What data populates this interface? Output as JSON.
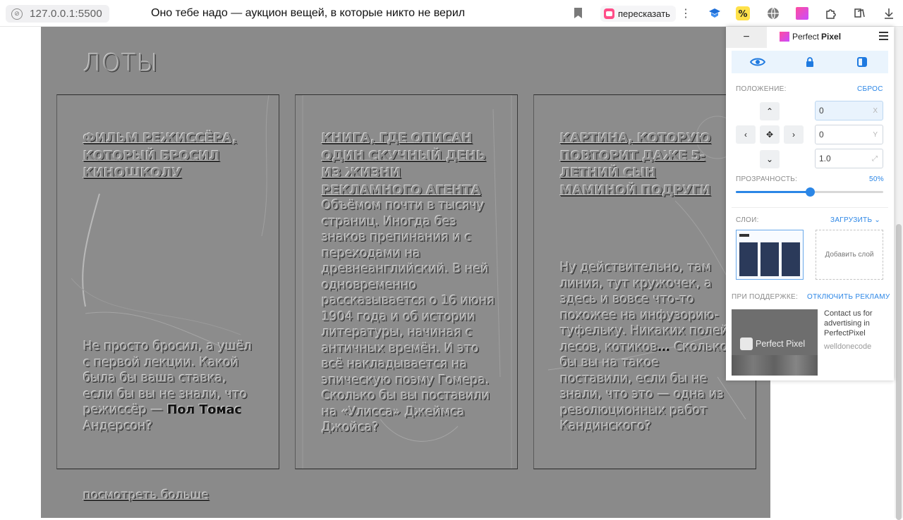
{
  "browser": {
    "url": "127.0.0.1:5500",
    "page_title": "Оно тебе надо — аукцион вещей, в которые никто не верил",
    "retell_label": "пересказать",
    "more_label": "⋮"
  },
  "section": {
    "title": "ЛОТЫ",
    "more_link": "посмотреть больше"
  },
  "cards": [
    {
      "title": "ФИЛЬМ РЕЖИССЁРА, КОТОРЫЙ БРОСИЛ КИНОШКОЛУ",
      "body_before": "Не просто бросил, а ушёл с первой лекции. Какой была бы ваша ставка, если бы вы не знали, что режиссёр — ",
      "body_highlight": "Пол Томас",
      "body_after": " Андерсон?"
    },
    {
      "title": "КНИГА, ГДЕ ОПИСАН ОДИН СКУЧНЫЙ ДЕНЬ ИЗ ЖИЗНИ РЕКЛАМНОГО АГЕНТА",
      "body_before": "Объёмом почти в тысячу страниц. Иногда без знаков препинания и с переходами на древнеанглийский. В ней одновременно рассказывается о 16 июня 1904 года и об истории литературы, начиная с античных времён. И это всё накладывается на эпическую поэму Гомера. Сколько бы вы поставили на «Улисса» Джеймса Джойса?",
      "body_highlight": "",
      "body_after": ""
    },
    {
      "title": "КАРТИНА, КОТОРУЮ ПОВТОРИТ ДАЖЕ 5-ЛЕТНИЙ СЫН МАМИНОЙ ПОДРУГИ",
      "body_before": "Ну действительно, там линия, тут кружочек, а здесь и вовсе что-то похожее на инфузорию-туфельку. Никаких полей, лесов, котиков",
      "body_highlight": "… ",
      "body_after": "Сколько бы вы на такое поставили, если бы не знали, что это — одна из революционных работ Кандинского?"
    }
  ],
  "perfect_pixel": {
    "minimize": "−",
    "brand_light": "Perfect",
    "brand_bold": "Pixel",
    "position_label": "ПОЛОЖЕНИЕ:",
    "reset_label": "СБРОС",
    "x_value": "0",
    "x_unit": "X",
    "y_value": "0",
    "y_unit": "Y",
    "scale_value": "1.0",
    "scale_unit": "⤢",
    "opacity_label": "ПРОЗРАЧНОСТЬ:",
    "opacity_value": "50%",
    "opacity_fraction": 0.5,
    "layers_label": "СЛОИ:",
    "upload_label": "ЗАГРУЗИТЬ",
    "add_layer_label": "Добавить слой",
    "support_label": "ПРИ ПОДДЕРЖКЕ:",
    "disable_ads_label": "ОТКЛЮЧИТЬ РЕКЛАМУ",
    "ad_title": "Perfect Pixel",
    "ad_side_text": "Contact us for advertising in PerfectPixel",
    "ad_side_sub": "welldonecode",
    "accent_color": "#2b86e6"
  }
}
